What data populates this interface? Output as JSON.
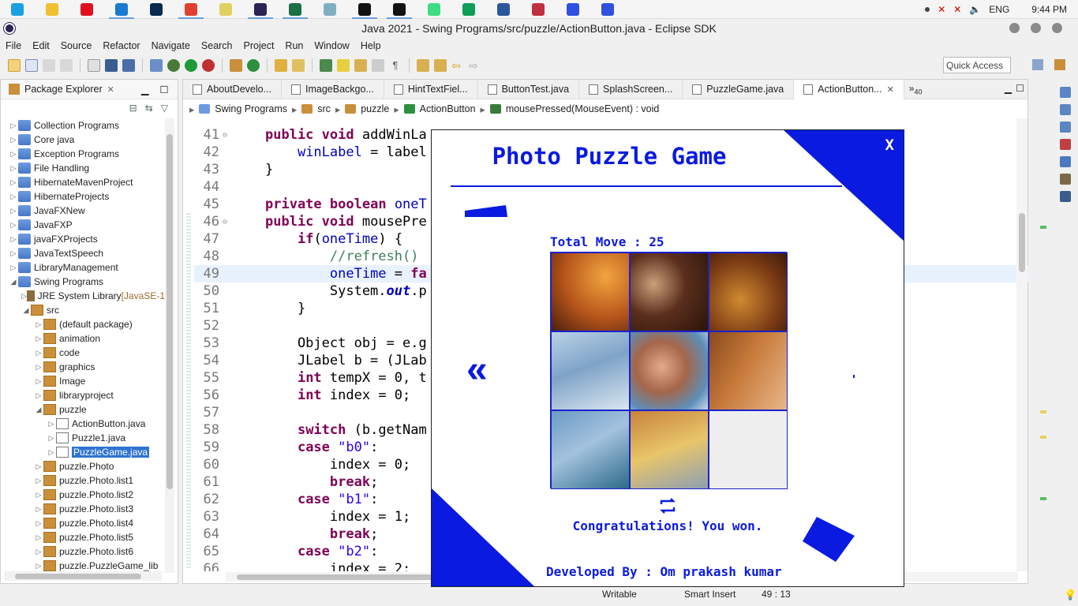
{
  "taskbar": {
    "apps": [
      {
        "name": "chrome-like-icon",
        "color": "#1aa0e0"
      },
      {
        "name": "file-explorer-icon",
        "color": "#f0c030"
      },
      {
        "name": "opera-icon",
        "color": "#e01020"
      },
      {
        "name": "vscode-icon",
        "color": "#1a7ad0"
      },
      {
        "name": "photoshop-icon",
        "color": "#0a2a50"
      },
      {
        "name": "chrome-icon",
        "color": "#e04030"
      },
      {
        "name": "notepad-icon",
        "color": "#e0d060"
      },
      {
        "name": "eclipse-icon",
        "color": "#2c2255"
      },
      {
        "name": "excel-icon",
        "color": "#1d7044"
      },
      {
        "name": "network-icon",
        "color": "#80b0c0"
      },
      {
        "name": "pycharm-icon",
        "color": "#111111"
      },
      {
        "name": "intellij-icon",
        "color": "#111111"
      },
      {
        "name": "android-icon",
        "color": "#3ddc84"
      },
      {
        "name": "sheets-icon",
        "color": "#0f9d58"
      },
      {
        "name": "word-icon",
        "color": "#2b579a"
      },
      {
        "name": "snip-icon",
        "color": "#c03040"
      },
      {
        "name": "puzzle-app-icon",
        "color": "#3050e0"
      },
      {
        "name": "puzzle-app-2-icon",
        "color": "#3050e0"
      }
    ],
    "language": "ENG",
    "time": "9:44 PM"
  },
  "window": {
    "title": "Java 2021 - Swing Programs/src/puzzle/ActionButton.java - Eclipse SDK"
  },
  "menu": [
    "File",
    "Edit",
    "Source",
    "Refactor",
    "Navigate",
    "Search",
    "Project",
    "Run",
    "Window",
    "Help"
  ],
  "quick_access": "Quick Access",
  "package_explorer": {
    "title": "Package Explorer",
    "items": [
      {
        "label": "Collection Programs",
        "icon": "proj",
        "indent": 0,
        "twisty": "▷"
      },
      {
        "label": "Core java",
        "icon": "proj",
        "indent": 0,
        "twisty": "▷"
      },
      {
        "label": "Exception Programs",
        "icon": "proj",
        "indent": 0,
        "twisty": "▷"
      },
      {
        "label": "File Handling",
        "icon": "proj",
        "indent": 0,
        "twisty": "▷"
      },
      {
        "label": "HibernateMavenProject",
        "icon": "proj",
        "indent": 0,
        "twisty": "▷"
      },
      {
        "label": "HibernateProjects",
        "icon": "proj",
        "indent": 0,
        "twisty": "▷"
      },
      {
        "label": "JavaFXNew",
        "icon": "proj",
        "indent": 0,
        "twisty": "▷"
      },
      {
        "label": "JavaFXP",
        "icon": "proj",
        "indent": 0,
        "twisty": "▷"
      },
      {
        "label": "javaFXProjects",
        "icon": "proj",
        "indent": 0,
        "twisty": "▷"
      },
      {
        "label": "JavaTextSpeech",
        "icon": "proj",
        "indent": 0,
        "twisty": "▷"
      },
      {
        "label": "LibraryManagement",
        "icon": "proj",
        "indent": 0,
        "twisty": "▷"
      },
      {
        "label": "Swing Programs",
        "icon": "proj",
        "indent": 0,
        "twisty": "◢"
      },
      {
        "label": "JRE System Library",
        "suffix": "[JavaSE-1",
        "icon": "lib",
        "indent": 1,
        "twisty": "▷"
      },
      {
        "label": "src",
        "icon": "pk",
        "indent": 1,
        "twisty": "◢"
      },
      {
        "label": "(default package)",
        "icon": "pk",
        "indent": 2,
        "twisty": "▷"
      },
      {
        "label": "animation",
        "icon": "pk",
        "indent": 2,
        "twisty": "▷"
      },
      {
        "label": "code",
        "icon": "pk",
        "indent": 2,
        "twisty": "▷"
      },
      {
        "label": "graphics",
        "icon": "pk",
        "indent": 2,
        "twisty": "▷"
      },
      {
        "label": "Image",
        "icon": "pk",
        "indent": 2,
        "twisty": "▷"
      },
      {
        "label": "libraryproject",
        "icon": "pk",
        "indent": 2,
        "twisty": "▷"
      },
      {
        "label": "puzzle",
        "icon": "pk",
        "indent": 2,
        "twisty": "◢"
      },
      {
        "label": "ActionButton.java",
        "icon": "jf",
        "indent": 3,
        "twisty": "▷"
      },
      {
        "label": "Puzzle1.java",
        "icon": "jf",
        "indent": 3,
        "twisty": "▷"
      },
      {
        "label": "PuzzleGame.java",
        "icon": "jf",
        "indent": 3,
        "twisty": "▷",
        "selected": true
      },
      {
        "label": "puzzle.Photo",
        "icon": "pk",
        "indent": 2,
        "twisty": "▷"
      },
      {
        "label": "puzzle.Photo.list1",
        "icon": "pk",
        "indent": 2,
        "twisty": "▷"
      },
      {
        "label": "puzzle.Photo.list2",
        "icon": "pk",
        "indent": 2,
        "twisty": "▷"
      },
      {
        "label": "puzzle.Photo.list3",
        "icon": "pk",
        "indent": 2,
        "twisty": "▷"
      },
      {
        "label": "puzzle.Photo.list4",
        "icon": "pk",
        "indent": 2,
        "twisty": "▷"
      },
      {
        "label": "puzzle.Photo.list5",
        "icon": "pk",
        "indent": 2,
        "twisty": "▷"
      },
      {
        "label": "puzzle.Photo.list6",
        "icon": "pk",
        "indent": 2,
        "twisty": "▷"
      },
      {
        "label": "puzzle.PuzzleGame_lib",
        "icon": "pk",
        "indent": 2,
        "twisty": "▷"
      }
    ]
  },
  "editor": {
    "tabs": [
      "AboutDevelo...",
      "ImageBackgo...",
      "HintTextFiel...",
      "ButtonTest.java",
      "SplashScreen...",
      "PuzzleGame.java",
      "ActionButton..."
    ],
    "active_tab": 6,
    "overflow_count": "40",
    "breadcrumb": [
      "Swing Programs",
      "src",
      "puzzle",
      "ActionButton",
      "mousePressed(MouseEvent) : void"
    ],
    "current_line": 49,
    "lines": [
      {
        "n": "41",
        "fold": "⊖",
        "html": "<span class=\"kw\">public</span> <span class=\"kw\">void</span> addWinLa"
      },
      {
        "n": "42",
        "html": "    <span class=\"fld\">winLabel</span> = label"
      },
      {
        "n": "43",
        "html": "}"
      },
      {
        "n": "44",
        "html": ""
      },
      {
        "n": "45",
        "html": "<span class=\"kw\">private</span> <span class=\"kw\">boolean</span> <span class=\"fld\">oneT</span>"
      },
      {
        "n": "46",
        "fold": "⊖",
        "html": "<span class=\"kw\">public</span> <span class=\"kw\">void</span> mousePre"
      },
      {
        "n": "47",
        "html": "    <span class=\"kw\">if</span>(<span class=\"fld\">oneTime</span>) {"
      },
      {
        "n": "48",
        "html": "        <span class=\"cmt\">//refresh()</span>"
      },
      {
        "n": "49",
        "html": "        <span class=\"fld\">oneTime</span> = <span class=\"kw\">fa</span>"
      },
      {
        "n": "50",
        "html": "        System.<span class=\"static\">out</span>.p"
      },
      {
        "n": "51",
        "html": "    }"
      },
      {
        "n": "52",
        "html": ""
      },
      {
        "n": "53",
        "html": "    Object obj = e.g"
      },
      {
        "n": "54",
        "html": "    JLabel b = (JLab"
      },
      {
        "n": "55",
        "html": "    <span class=\"kw\">int</span> tempX = 0, t"
      },
      {
        "n": "56",
        "html": "    <span class=\"kw\">int</span> index = 0;"
      },
      {
        "n": "57",
        "html": ""
      },
      {
        "n": "58",
        "html": "    <span class=\"kw\">switch</span> (b.getNam"
      },
      {
        "n": "59",
        "html": "    <span class=\"kw\">case</span> <span class=\"str\">\"b0\"</span>:"
      },
      {
        "n": "60",
        "html": "        index = 0;"
      },
      {
        "n": "61",
        "html": "        <span class=\"kw\">break</span>;"
      },
      {
        "n": "62",
        "html": "    <span class=\"kw\">case</span> <span class=\"str\">\"b1\"</span>:"
      },
      {
        "n": "63",
        "html": "        index = 1;"
      },
      {
        "n": "64",
        "html": "        <span class=\"kw\">break</span>;"
      },
      {
        "n": "65",
        "html": "    <span class=\"kw\">case</span> <span class=\"str\">\"b2\"</span>:"
      },
      {
        "n": "66",
        "html": "        index = 2;"
      }
    ]
  },
  "status": {
    "writable": "Writable",
    "insert_mode": "Smart Insert",
    "position": "49 : 13"
  },
  "puzzle_game": {
    "title": "Photo Puzzle Game",
    "close": "X",
    "moves": "Total Move : 25",
    "message": "Congratulations! You won.",
    "developer": "Developed By : Om prakash kumar",
    "accent_color": "#0a1ae0",
    "tiles": [
      0,
      1,
      2,
      3,
      4,
      5,
      6,
      7,
      null
    ]
  }
}
